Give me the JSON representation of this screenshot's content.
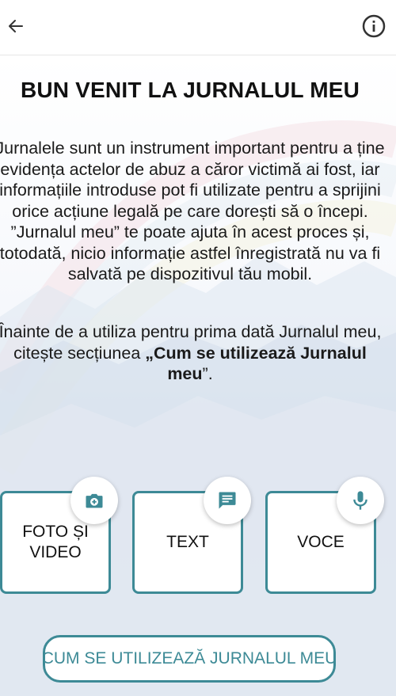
{
  "header": {
    "back_icon": "arrow-left-icon",
    "info_icon": "info-circle-icon"
  },
  "main": {
    "title": "BUN VENIT LA JURNALUL MEU",
    "intro_text": "Jurnalele sunt un instrument important pentru a ține evidența actelor de abuz a căror victimă ai fost, iar informațiile introduse pot fi utilizate pentru a sprijini orice acțiune legală pe care dorești să o începi. ”Jurnalul meu” te poate ajuta în acest proces și, totodată, nicio informație astfel înregistrată nu va fi salvată pe dispozitivul tău mobil.",
    "note_prefix": "Înainte de a utiliza pentru prima dată Jurnalul meu, citește secțiunea ",
    "note_bold": "„Cum se utilizează Jurnalul meu",
    "note_suffix": "”."
  },
  "cards": [
    {
      "label": "FOTO ȘI VIDEO",
      "icon": "camera-icon"
    },
    {
      "label": "TEXT",
      "icon": "message-icon"
    },
    {
      "label": "VOCE",
      "icon": "microphone-icon"
    }
  ],
  "how_to_button": "CUM SE UTILIZEAZĂ JURNALUL MEU",
  "colors": {
    "accent": "#3d8a96",
    "text": "#111111",
    "background": "#ffffff"
  }
}
